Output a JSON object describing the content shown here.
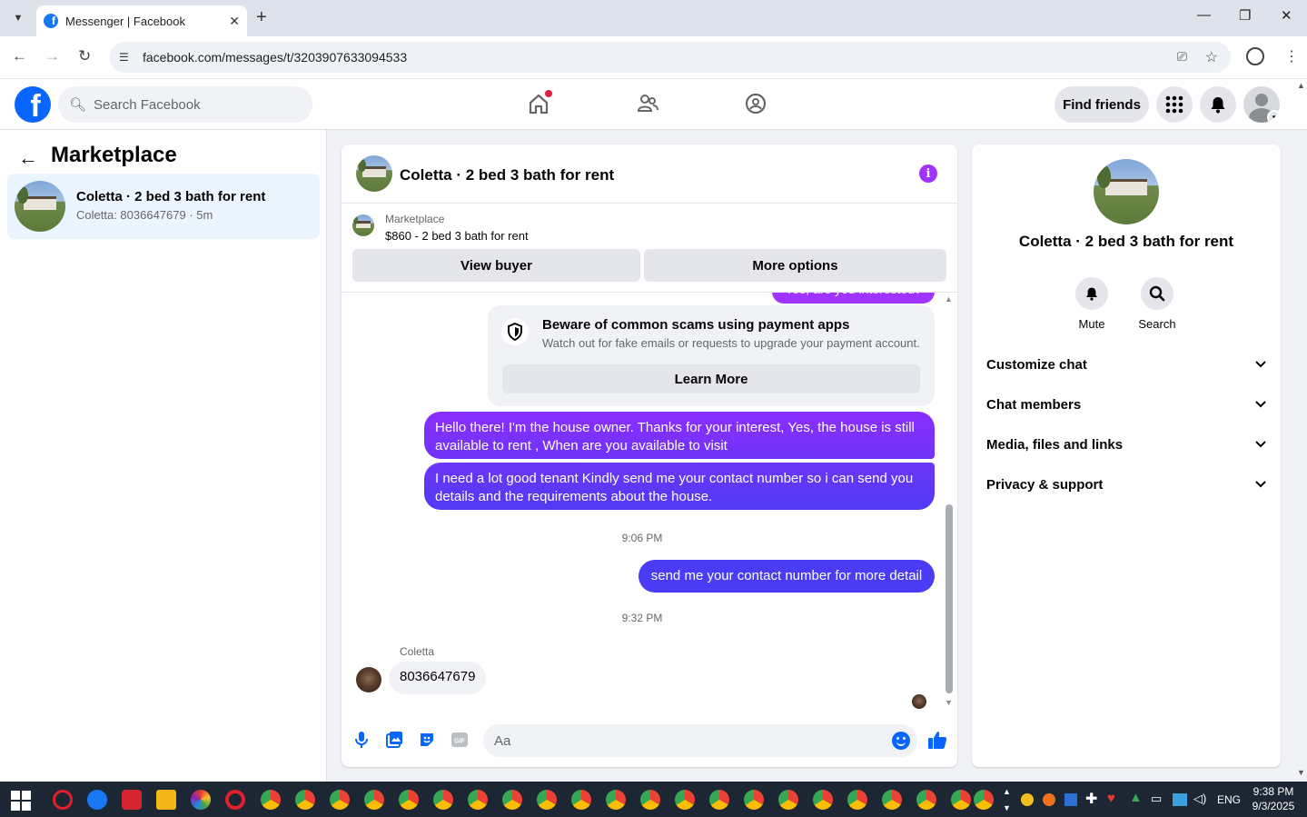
{
  "browser": {
    "tab_title": "Messenger | Facebook",
    "url": "facebook.com/messages/t/3203907633094533"
  },
  "fb": {
    "search_placeholder": "Search Facebook",
    "find_friends": "Find friends",
    "home_has_notification": true
  },
  "left_panel": {
    "title": "Marketplace",
    "conversations": [
      {
        "name": "Coletta · 2 bed 3 bath for rent",
        "preview": "Coletta: 8036647679 · 5m"
      }
    ]
  },
  "chat": {
    "title": "Coletta · 2 bed 3 bath for rent",
    "marketplace_label": "Marketplace",
    "listing": "$860 - 2 bed 3 bath for rent",
    "view_buyer": "View buyer",
    "more_options": "More options",
    "partial_message": "Yes, are you interested?",
    "scam_notice": {
      "title": "Beware of common scams using payment apps",
      "description": "Watch out for fake emails or requests to upgrade your payment account.",
      "button": "Learn More"
    },
    "messages_out_1": [
      "Hello there! I'm the house owner. Thanks for your interest, Yes, the house is still available to rent , When are you available to visit",
      "I need a lot good tenant Kindly send me your contact number so i can send you details and the requirements about the house."
    ],
    "time_1": "9:06 PM",
    "message_out_2": "send me your contact number for more detail",
    "time_2": "9:32 PM",
    "incoming_sender": "Coletta",
    "incoming_message": "8036647679",
    "composer_placeholder": "Aa",
    "colors": {
      "accent": "#a033ff",
      "bubble_gradient_top": "#8a2eff",
      "bubble_gradient_bottom": "#4a3cf5"
    }
  },
  "right_panel": {
    "title": "Coletta · 2 bed 3 bath for rent",
    "mute": "Mute",
    "search": "Search",
    "sections": [
      "Customize chat",
      "Chat members",
      "Media, files and links",
      "Privacy & support"
    ]
  },
  "taskbar": {
    "language": "ENG",
    "time": "9:38 PM",
    "date": "9/3/2025"
  }
}
